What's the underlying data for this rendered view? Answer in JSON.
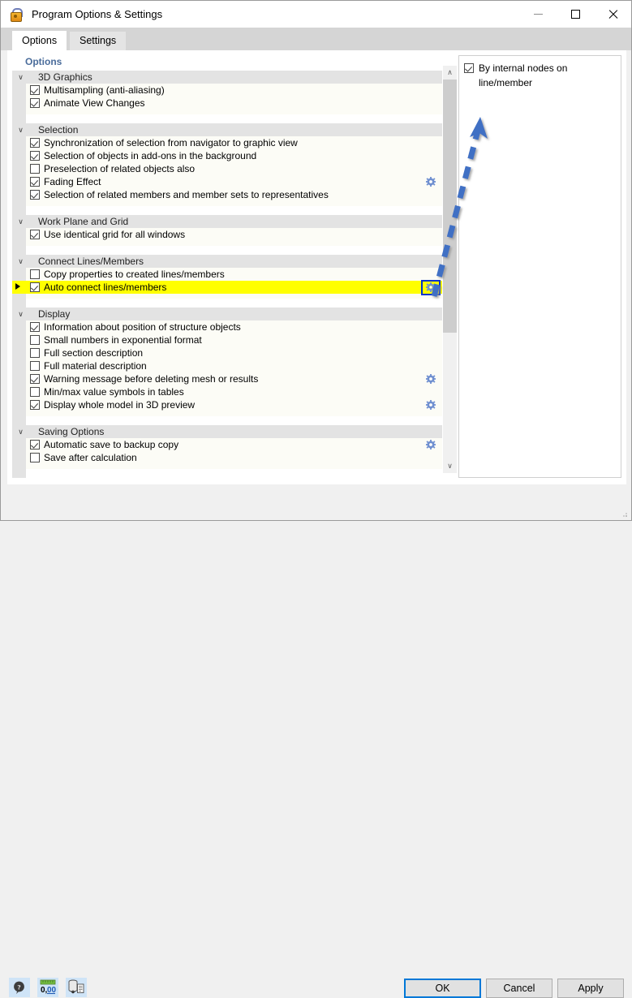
{
  "window": {
    "title": "Program Options & Settings",
    "icon": "lock-icon",
    "minimize_label": "Minimize",
    "maximize_label": "Maximize",
    "close_label": "Close"
  },
  "tabs": [
    {
      "label": "Options",
      "active": true
    },
    {
      "label": "Settings",
      "active": false
    }
  ],
  "left_panel": {
    "header": "Options",
    "groups": [
      {
        "title": "3D Graphics",
        "expanded": true,
        "rows": [
          {
            "label": "Multisampling (anti-aliasing)",
            "checked": true,
            "gear": false
          },
          {
            "label": "Animate View Changes",
            "checked": true,
            "gear": false
          }
        ]
      },
      {
        "title": "Selection",
        "expanded": true,
        "rows": [
          {
            "label": "Synchronization of selection from navigator to graphic view",
            "checked": true,
            "gear": false
          },
          {
            "label": "Selection of objects in add-ons in the background",
            "checked": true,
            "gear": false
          },
          {
            "label": "Preselection of related objects also",
            "checked": false,
            "gear": false
          },
          {
            "label": "Fading Effect",
            "checked": true,
            "gear": true
          },
          {
            "label": "Selection of related members and member sets to representatives",
            "checked": true,
            "gear": false
          }
        ]
      },
      {
        "title": "Work Plane and Grid",
        "expanded": true,
        "rows": [
          {
            "label": "Use identical grid for all windows",
            "checked": true,
            "gear": false
          }
        ]
      },
      {
        "title": "Connect Lines/Members",
        "expanded": true,
        "rows": [
          {
            "label": "Copy properties to created lines/members",
            "checked": false,
            "gear": false
          },
          {
            "label": "Auto connect lines/members",
            "checked": true,
            "gear": true,
            "highlighted": true,
            "marker": true,
            "gear_focused": true
          }
        ]
      },
      {
        "title": "Display",
        "expanded": true,
        "rows": [
          {
            "label": "Information about position of structure objects",
            "checked": true,
            "gear": false
          },
          {
            "label": "Small numbers in exponential format",
            "checked": false,
            "gear": false
          },
          {
            "label": "Full section description",
            "checked": false,
            "gear": false
          },
          {
            "label": "Full material description",
            "checked": false,
            "gear": false
          },
          {
            "label": "Warning message before deleting mesh or results",
            "checked": true,
            "gear": true
          },
          {
            "label": "Min/max value symbols in tables",
            "checked": false,
            "gear": false
          },
          {
            "label": "Display whole model in 3D preview",
            "checked": true,
            "gear": true
          }
        ]
      },
      {
        "title": "Saving Options",
        "expanded": true,
        "rows": [
          {
            "label": "Automatic save to backup copy",
            "checked": true,
            "gear": true
          },
          {
            "label": "Save after calculation",
            "checked": false,
            "gear": false
          }
        ]
      }
    ]
  },
  "right_panel": {
    "rows": [
      {
        "label": "By internal nodes on line/member",
        "checked": true
      }
    ]
  },
  "annotation": {
    "arrow": "blue-dashed-arrow",
    "color": "#3f6fc4"
  },
  "scrollbar": {
    "up_glyph": "∧",
    "down_glyph": "∨"
  },
  "footer": {
    "tools": [
      {
        "name": "help-icon",
        "label": "Help"
      },
      {
        "name": "decimals-icon",
        "label": "0,00"
      },
      {
        "name": "database-import-icon",
        "label": "Import"
      }
    ],
    "buttons": [
      {
        "label": "OK",
        "primary": true
      },
      {
        "label": "Cancel",
        "primary": false
      },
      {
        "label": "Apply",
        "primary": false
      }
    ]
  },
  "colors": {
    "accent": "#0078d7",
    "highlight": "#ffff00",
    "gear": "#6f8fd0",
    "header_text": "#4a6c9b",
    "focus_box": "#0033cc"
  }
}
